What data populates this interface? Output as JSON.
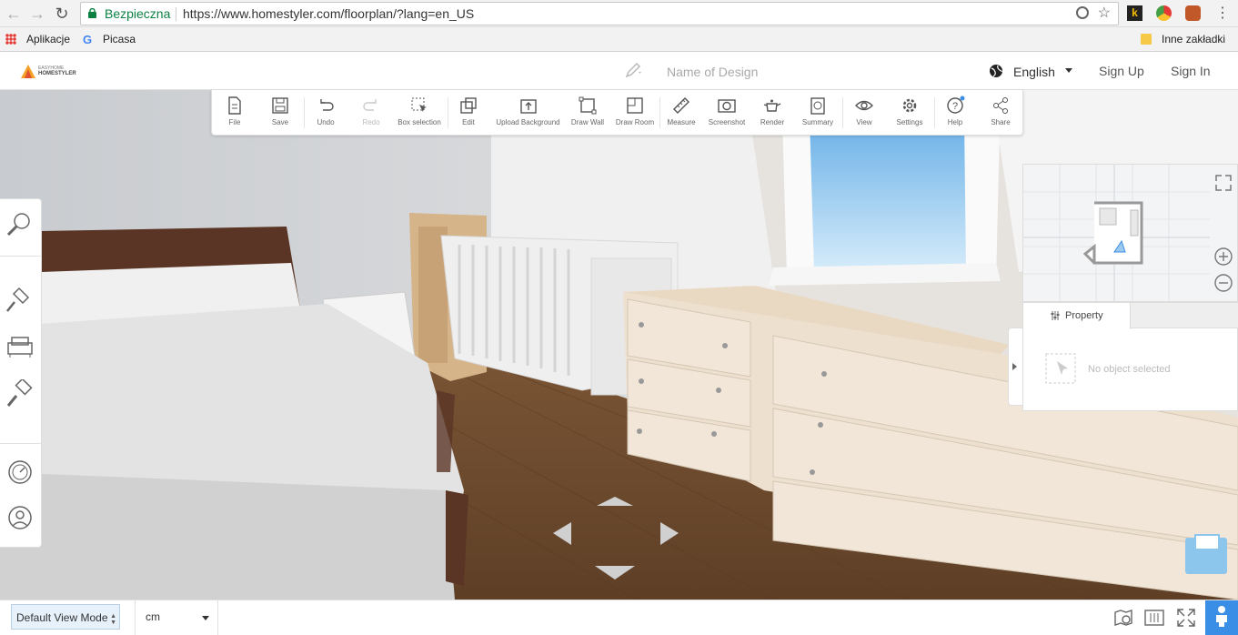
{
  "browser": {
    "secure_label": "Bezpieczna",
    "url": "https://www.homestyler.com/floorplan/?lang=en_US",
    "bookmarks": {
      "apps": "Aplikacje",
      "picasa": "Picasa",
      "other": "Inne zakładki"
    }
  },
  "header": {
    "logo_top": "EASYHOME",
    "logo_bottom": "HOMESTYLER",
    "design_name_placeholder": "Name of Design",
    "language": "English",
    "sign_up": "Sign Up",
    "sign_in": "Sign In"
  },
  "toolbar": {
    "file": "File",
    "save": "Save",
    "undo": "Undo",
    "redo": "Redo",
    "box_selection": "Box selection",
    "edit": "Edit",
    "upload_background": "Upload Background",
    "draw_wall": "Draw Wall",
    "draw_room": "Draw Room",
    "measure": "Measure",
    "screenshot": "Screenshot",
    "render": "Render",
    "summary": "Summary",
    "view": "View",
    "settings": "Settings",
    "help": "Help",
    "share": "Share"
  },
  "property": {
    "tab": "Property",
    "empty": "No object selected"
  },
  "status": {
    "view_mode": "Default View Mode",
    "unit": "cm"
  },
  "colors": {
    "accent": "#3a8ee6",
    "secure": "#0b8043",
    "floor": "#6e4a2e"
  }
}
